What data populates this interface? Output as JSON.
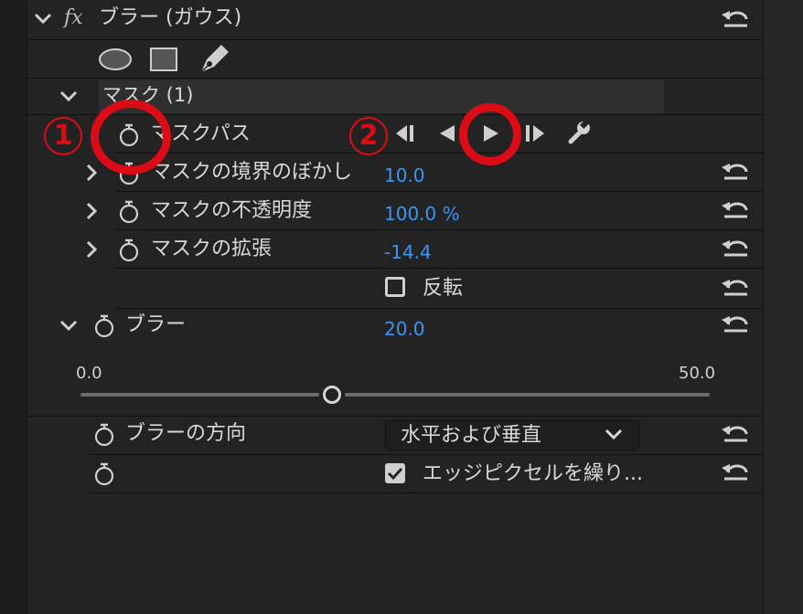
{
  "effect": {
    "fx_label": "fx",
    "title": "ブラー (ガウス)"
  },
  "mask": {
    "title": "マスク (1)",
    "path_label": "マスクパス",
    "feather_label": "マスクの境界のぼかし",
    "feather_value": "10.0",
    "opacity_label": "マスクの不透明度",
    "opacity_value": "100.0 %",
    "expansion_label": "マスクの拡張",
    "expansion_value": "-14.4",
    "invert_label": "反転"
  },
  "blur": {
    "label": "ブラー",
    "value": "20.0",
    "slider_min": "0.0",
    "slider_max": "50.0",
    "slider_fraction": 0.4,
    "direction_label": "ブラーの方向",
    "direction_value": "水平および垂直",
    "repeat_label": "エッジピクセルを繰り..."
  },
  "annotations": {
    "num1": "1",
    "num2": "2"
  },
  "colors": {
    "accent_value": "#3b95f3",
    "annotation_red": "#dd0b15"
  }
}
